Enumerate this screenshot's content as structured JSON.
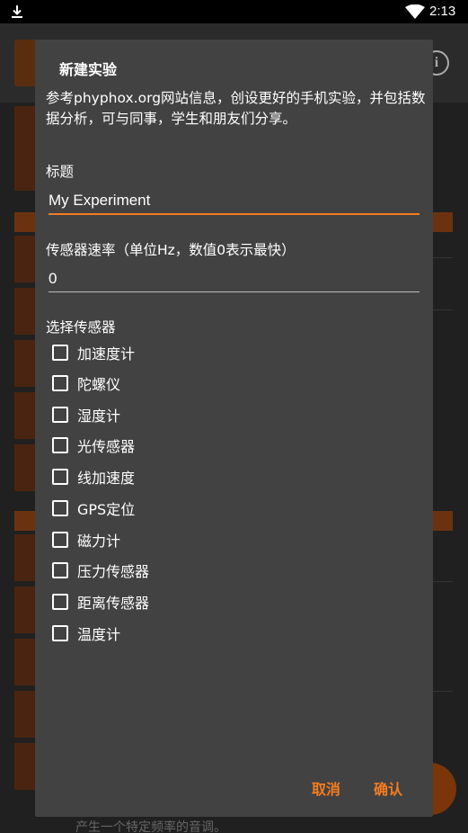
{
  "status_bar": {
    "time": "2:13"
  },
  "background": {
    "footer_text": "产生一个特定频率的音调。"
  },
  "dialog": {
    "title": "新建实验",
    "description": "参考phyphox.org网站信息，创设更好的手机实验，并包括数据分析，可与同事，学生和朋友们分享。",
    "title_field": {
      "label": "标题",
      "value": "My Experiment"
    },
    "rate_field": {
      "label": "传感器速率（单位Hz，数值0表示最快）",
      "value": "0"
    },
    "sensors_label": "选择传感器",
    "sensors": [
      {
        "label": "加速度计",
        "checked": false
      },
      {
        "label": "陀螺仪",
        "checked": false
      },
      {
        "label": "湿度计",
        "checked": false
      },
      {
        "label": "光传感器",
        "checked": false
      },
      {
        "label": "线加速度",
        "checked": false
      },
      {
        "label": "GPS定位",
        "checked": false
      },
      {
        "label": "磁力计",
        "checked": false
      },
      {
        "label": "压力传感器",
        "checked": false
      },
      {
        "label": "距离传感器",
        "checked": false
      },
      {
        "label": "温度计",
        "checked": false
      }
    ],
    "cancel_label": "取消",
    "confirm_label": "确认"
  },
  "colors": {
    "accent": "#f57c1f",
    "dialog_bg": "#424242",
    "text": "#ffffff"
  }
}
